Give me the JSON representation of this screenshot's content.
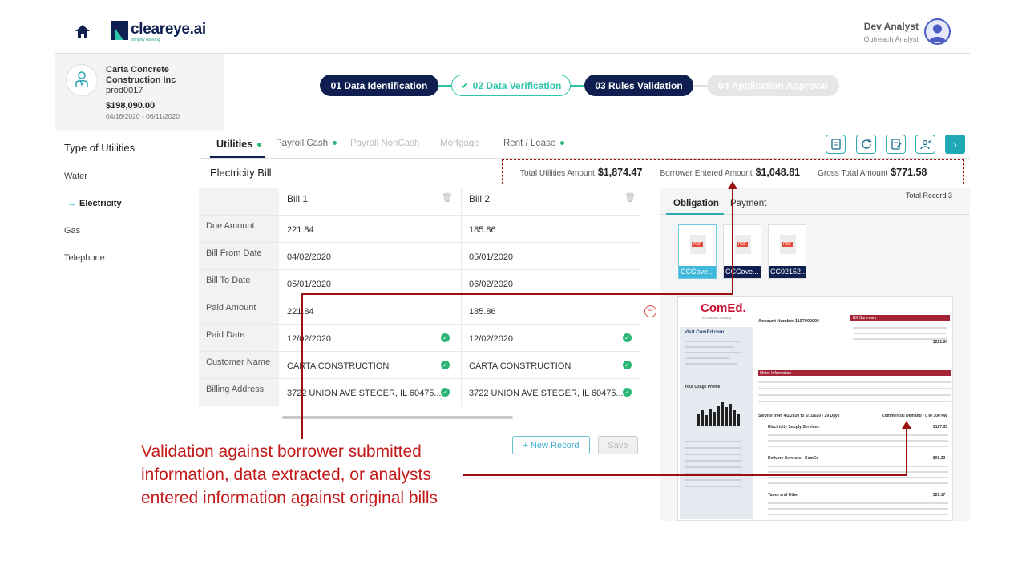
{
  "header": {
    "logo_text": "cleareye.ai",
    "logo_tagline": "simplify banking",
    "user_name": "Dev Analyst",
    "user_role": "Outreach Analyst"
  },
  "company": {
    "name": "Carta Concrete Construction Inc",
    "id": "prod0017",
    "amount": "$198,090.00",
    "dates": "04/16/2020 - 06/11/2020"
  },
  "steps": [
    {
      "label": "01 Data Identification",
      "state": "done"
    },
    {
      "label": "02 Data Verification",
      "state": "active"
    },
    {
      "label": "03 Rules Validation",
      "state": "done"
    },
    {
      "label": "04 Application Approval",
      "state": "future"
    }
  ],
  "nav": {
    "title": "Type of Utilities",
    "items": [
      "Water",
      "Electricity",
      "Gas",
      "Telephone"
    ],
    "active": "Electricity"
  },
  "tabs": [
    {
      "label": "Utilities",
      "dot": true,
      "state": "active"
    },
    {
      "label": "Payroll Cash",
      "dot": true,
      "state": "normal"
    },
    {
      "label": "Payroll NonCash",
      "dot": false,
      "state": "disabled"
    },
    {
      "label": "Mortgage",
      "dot": false,
      "state": "disabled"
    },
    {
      "label": "Rent / Lease",
      "dot": true,
      "state": "normal"
    }
  ],
  "bill": {
    "title": "Electricity Bill",
    "totals": [
      {
        "label": "Total Utilities Amount",
        "value": "$1,874.47"
      },
      {
        "label": "Borrower Entered Amount",
        "value": "$1,048.81"
      },
      {
        "label": "Gross Total Amount",
        "value": "$771.58"
      }
    ],
    "columns": [
      "Bill 1",
      "Bill 2"
    ],
    "rows": [
      {
        "label": "Due Amount",
        "values": [
          "221.84",
          "185.86"
        ],
        "verified": false
      },
      {
        "label": "Bill From Date",
        "values": [
          "04/02/2020",
          "05/01/2020"
        ],
        "verified": false
      },
      {
        "label": "Bill To Date",
        "values": [
          "05/01/2020",
          "06/02/2020"
        ],
        "verified": false
      },
      {
        "label": "Paid Amount",
        "values": [
          "221.84",
          "185.86"
        ],
        "verified": false
      },
      {
        "label": "Paid Date",
        "values": [
          "12/02/2020",
          "12/02/2020"
        ],
        "verified": true
      },
      {
        "label": "Customer Name",
        "values": [
          "CARTA CONSTRUCTION",
          "CARTA CONSTRUCTION"
        ],
        "verified": true
      },
      {
        "label": "Billing Address",
        "values": [
          "3722 UNION AVE STEGER, IL 60475...",
          "3722 UNION AVE STEGER, IL 60475..."
        ],
        "verified": true
      }
    ],
    "new_record_label": "+ New Record",
    "save_label": "Save"
  },
  "documents": {
    "tabs": [
      "Obligation",
      "Payment"
    ],
    "total_record": "Total Record 3",
    "files": [
      "CCCove...",
      "CCCove...",
      "CC02152..."
    ],
    "preview": {
      "brand": "ComEd.",
      "brand_sub": "An Exelon Company",
      "account": "Account Number 1107002096",
      "summary_title": "Bill Summary",
      "site_link": "Visit ComEd.com",
      "usage_title": "Your Usage Profile",
      "meter_title": "Meter Information",
      "service_period": "Service from 4/2/2020 to 5/1/2020 - 29 Days",
      "demand": "Commercial Demand - 0 to 100 kW",
      "supply_title": "Electricity Supply Services",
      "supply_total": "$127.35",
      "delivery_title": "Delivery Services - ComEd",
      "delivery_total": "$68.32",
      "taxes_title": "Taxes and Other",
      "taxes_total": "$26.17",
      "amount_due": "$221.84"
    }
  },
  "annotation": "Validation against borrower submitted information, data extracted, or analysts entered information against original bills",
  "colors": {
    "navy": "#0f1f4f",
    "teal": "#2cc3a7",
    "annotation_red": "#c21a1a",
    "check_green": "#2bb574"
  }
}
